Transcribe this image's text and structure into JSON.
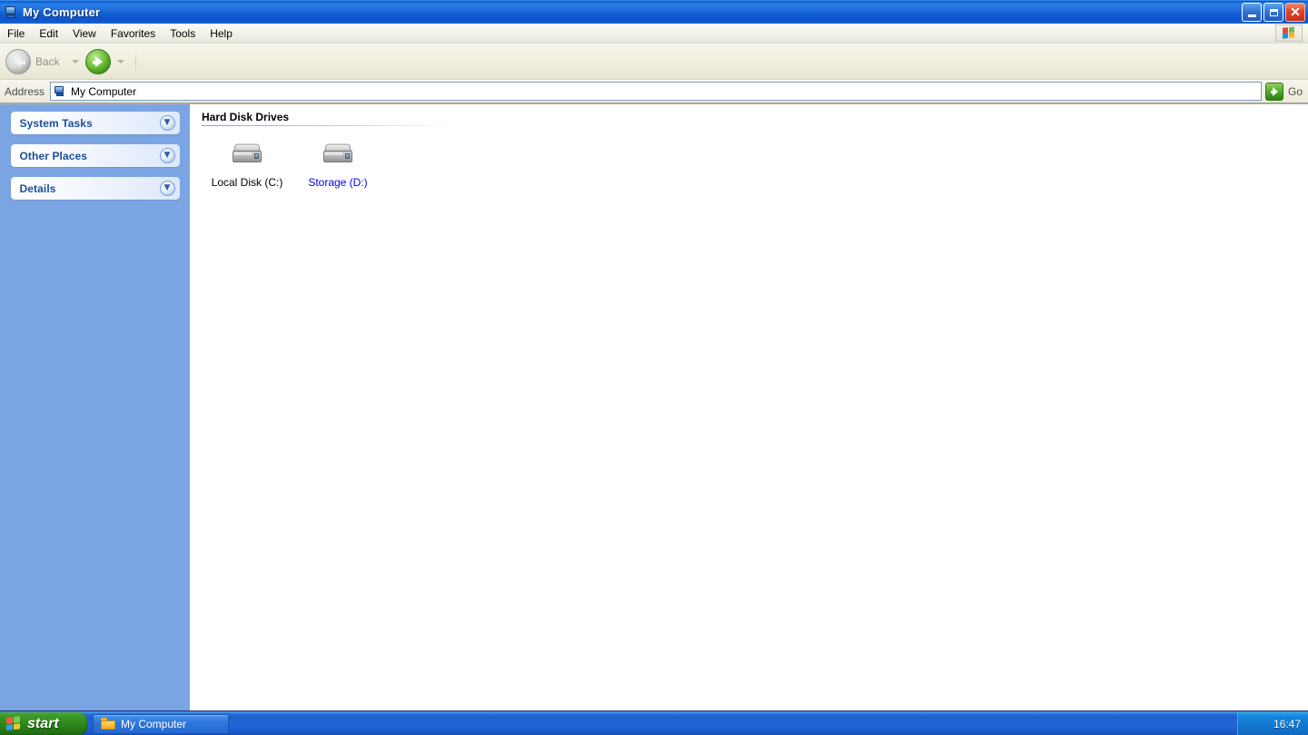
{
  "window": {
    "title": "My Computer",
    "title_icon": "my-computer-icon",
    "controls": {
      "minimize_label": "Minimize",
      "maximize_label": "Restore",
      "close_label": "Close"
    }
  },
  "menubar": {
    "items": [
      {
        "label": "File"
      },
      {
        "label": "Edit"
      },
      {
        "label": "View"
      },
      {
        "label": "Favorites"
      },
      {
        "label": "Tools"
      },
      {
        "label": "Help"
      }
    ],
    "brand_icon": "windows-flag-icon"
  },
  "toolbar": {
    "back_label": "Back",
    "back_icon": "back-arrow-icon",
    "back_enabled": "false",
    "forward_icon": "forward-arrow-icon",
    "forward_enabled": "true"
  },
  "address": {
    "label": "Address",
    "value": "My Computer",
    "placeholder": "My Computer",
    "icon": "my-computer-icon",
    "go_label": "Go",
    "go_icon": "go-arrow-icon"
  },
  "sidebar": {
    "panels": [
      {
        "title": "System Tasks",
        "state": "collapsed",
        "toggle_icon": "chevron-double-down-icon"
      },
      {
        "title": "Other Places",
        "state": "collapsed",
        "toggle_icon": "chevron-double-down-icon"
      },
      {
        "title": "Details",
        "state": "collapsed",
        "toggle_icon": "chevron-double-down-icon"
      }
    ]
  },
  "content": {
    "group_title": "Hard Disk Drives",
    "drives": [
      {
        "label": "Local Disk (C:)",
        "icon": "hard-drive-icon",
        "hovered": "false"
      },
      {
        "label": "Storage (D:)",
        "icon": "hard-drive-icon",
        "hovered": "true"
      }
    ]
  },
  "taskbar": {
    "start_label": "start",
    "start_icon": "windows-flag-icon",
    "tasks": [
      {
        "label": "My Computer",
        "icon": "folder-icon",
        "active": "true"
      }
    ],
    "clock": "16:47"
  },
  "colors": {
    "titlebar_blue": "#1b6fe0",
    "sidebar_blue": "#7ba4e3",
    "panel_title": "#1b4f9c",
    "link_blue": "#0000ee",
    "taskbar_blue": "#2266d4",
    "start_green": "#2f8b1e",
    "close_red": "#e0442a",
    "go_green": "#4fa82a"
  }
}
